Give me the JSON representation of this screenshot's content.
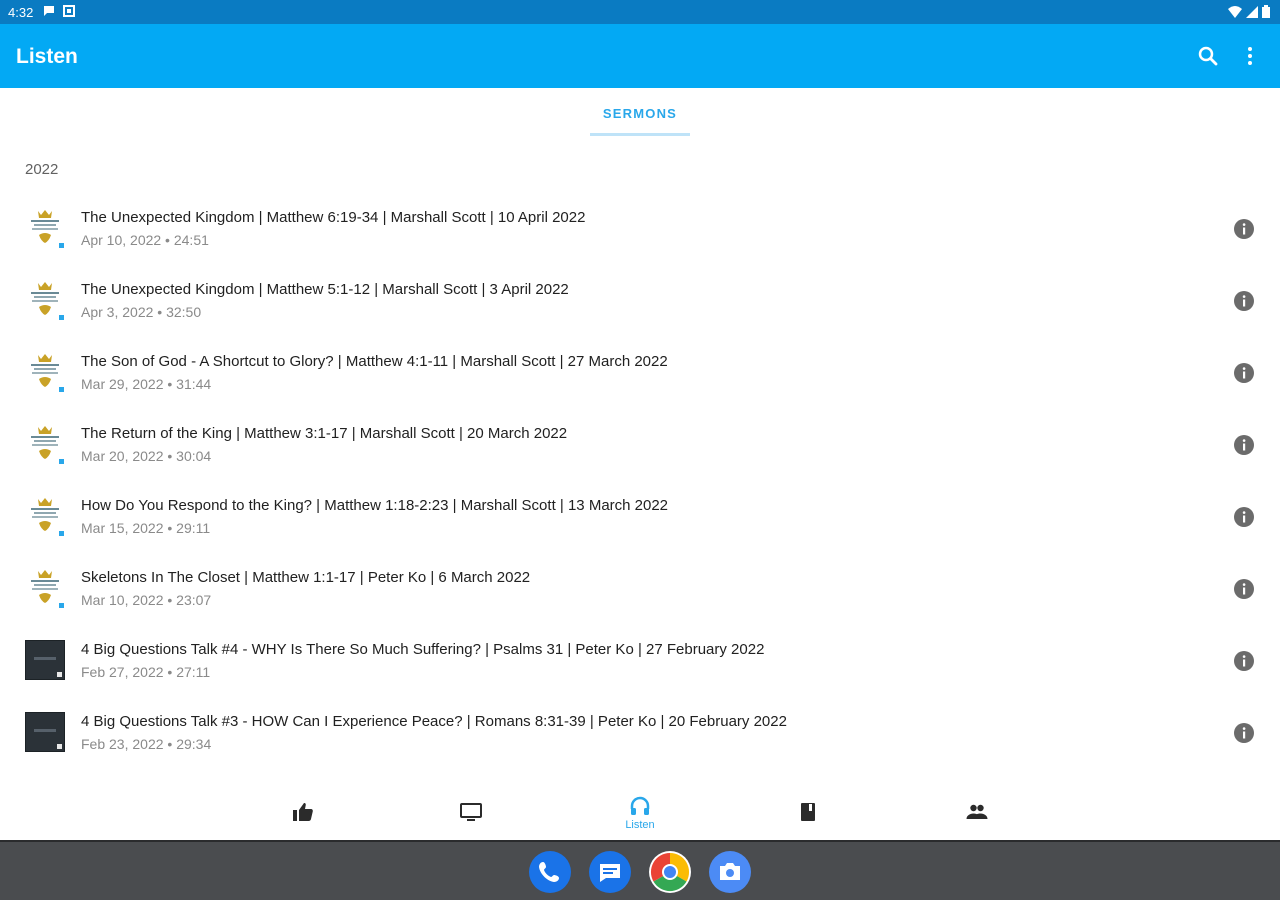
{
  "status_bar": {
    "time": "4:32"
  },
  "app_bar": {
    "title": "Listen"
  },
  "tabs": [
    {
      "label": "SERMONS"
    }
  ],
  "section": {
    "year": "2022"
  },
  "episodes": [
    {
      "title": "The Unexpected Kingdom | Matthew 6:19-34 | Marshall Scott | 10 April 2022",
      "subtitle": "Apr 10, 2022 • 24:51",
      "thumbnail": "crown-logo"
    },
    {
      "title": "The Unexpected Kingdom | Matthew 5:1-12 | Marshall Scott | 3 April 2022",
      "subtitle": "Apr 3, 2022 • 32:50",
      "thumbnail": "crown-logo"
    },
    {
      "title": "The Son of God - A Shortcut to Glory? | Matthew 4:1-11 | Marshall Scott | 27 March 2022",
      "subtitle": "Mar 29, 2022 • 31:44",
      "thumbnail": "crown-logo"
    },
    {
      "title": "The Return of the King | Matthew 3:1-17 | Marshall Scott | 20 March 2022",
      "subtitle": "Mar 20, 2022 • 30:04",
      "thumbnail": "crown-logo"
    },
    {
      "title": "How Do You Respond to the King? | Matthew 1:18-2:23 | Marshall Scott | 13 March 2022",
      "subtitle": "Mar 15, 2022 • 29:11",
      "thumbnail": "crown-logo"
    },
    {
      "title": "Skeletons In The Closet | Matthew 1:1-17 | Peter Ko | 6 March 2022",
      "subtitle": "Mar 10, 2022 • 23:07",
      "thumbnail": "crown-logo"
    },
    {
      "title": "4 Big Questions Talk #4 - WHY Is There So Much Suffering? | Psalms 31 | Peter Ko | 27 February 2022",
      "subtitle": "Feb 27, 2022 • 27:11",
      "thumbnail": "dark-cover"
    },
    {
      "title": "4 Big Questions Talk #3 - HOW Can I Experience Peace? | Romans 8:31-39 | Peter Ko | 20 February 2022",
      "subtitle": "Feb 23, 2022 • 29:34",
      "thumbnail": "dark-cover"
    }
  ],
  "bottom_nav": {
    "items": [
      {
        "icon": "thumbs-up-icon",
        "label": ""
      },
      {
        "icon": "tv-icon",
        "label": ""
      },
      {
        "icon": "headphones-icon",
        "label": "Listen"
      },
      {
        "icon": "book-icon",
        "label": ""
      },
      {
        "icon": "people-icon",
        "label": ""
      }
    ],
    "active_index": 2
  },
  "dock": {
    "apps": [
      "phone",
      "messages",
      "chrome",
      "camera"
    ]
  },
  "colors": {
    "status_bar": "#0a7bc2",
    "app_bar": "#03a9f4",
    "accent": "#29a7ea",
    "dock": "#4a4c4f"
  }
}
